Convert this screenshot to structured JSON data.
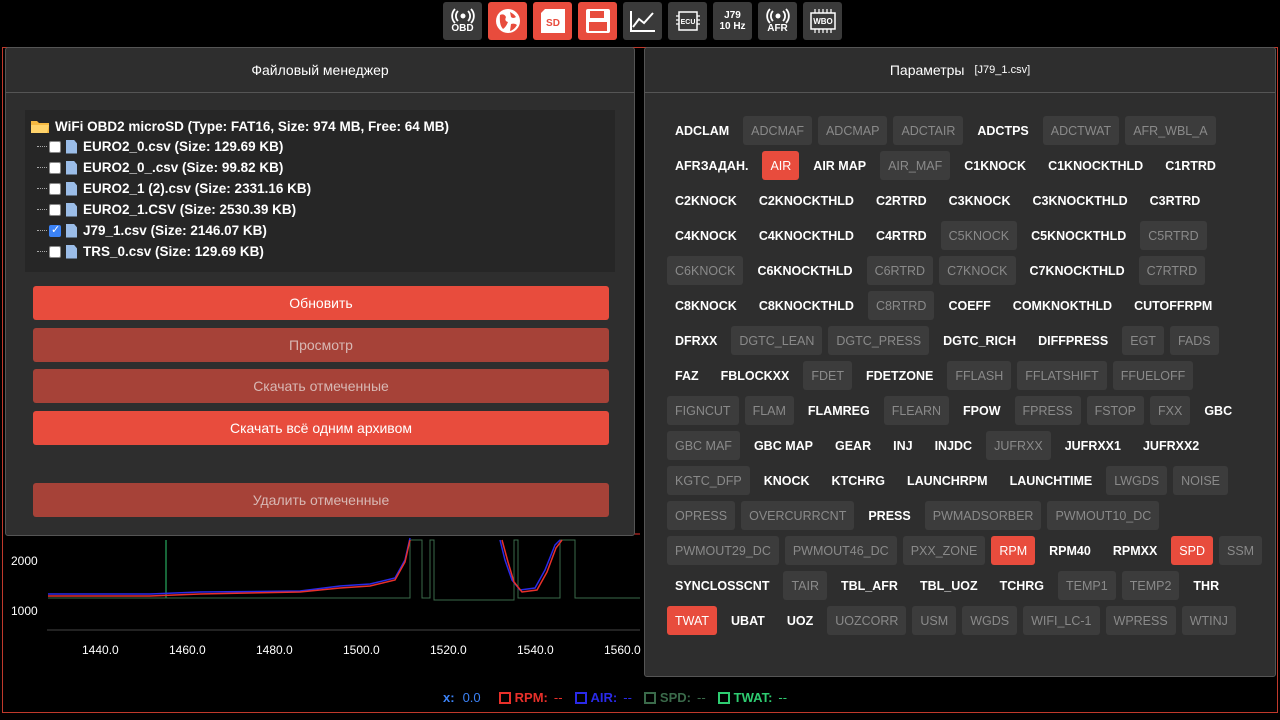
{
  "toolbar": [
    {
      "label": "OBD",
      "icon": "wireless-icon",
      "active": false
    },
    {
      "label": "",
      "icon": "globe-icon",
      "active": true
    },
    {
      "label": "SD",
      "icon": "sd-card-icon",
      "active": true
    },
    {
      "label": "",
      "icon": "floppy-disk-icon",
      "active": true
    },
    {
      "label": "",
      "icon": "chart-icon",
      "active": false
    },
    {
      "label": "ECU",
      "icon": "ecu-chip-icon",
      "active": false
    },
    {
      "label": "J79\n10 Hz",
      "icon": "",
      "active": false
    },
    {
      "label": "AFR",
      "icon": "wireless-icon",
      "active": false
    },
    {
      "label": "WBO",
      "icon": "wbo-chip-icon",
      "active": false
    }
  ],
  "chart": {
    "y_ticks": [
      "2000",
      "1000"
    ],
    "x_ticks": [
      "1440.0",
      "1460.0",
      "1480.0",
      "1500.0",
      "1520.0",
      "1540.0",
      "1560.0"
    ]
  },
  "legend": {
    "x_label": "x:",
    "x_value": "0.0",
    "series": [
      {
        "name": "RPM:",
        "value": "--",
        "color": "#e8302a"
      },
      {
        "name": "AIR:",
        "value": "--",
        "color": "#2a2ae8"
      },
      {
        "name": "SPD:",
        "value": "--",
        "color": "#3a6a4a"
      },
      {
        "name": "TWAT:",
        "value": "--",
        "color": "#2ecc71"
      }
    ]
  },
  "file_manager": {
    "title": "Файловый менеджер",
    "root": "WiFi OBD2 microSD (Type: FAT16, Size: 974 MB, Free: 64 MB)",
    "files": [
      {
        "name": "EURO2_0.csv (Size: 129.69 KB)",
        "checked": false
      },
      {
        "name": "EURO2_0_.csv (Size: 99.82 KB)",
        "checked": false
      },
      {
        "name": "EURO2_1 (2).csv (Size: 2331.16 KB)",
        "checked": false
      },
      {
        "name": "EURO2_1.CSV (Size: 2530.39 KB)",
        "checked": false
      },
      {
        "name": "J79_1.csv (Size: 2146.07 KB)",
        "checked": true
      },
      {
        "name": "TRS_0.csv (Size: 129.69 KB)",
        "checked": false
      }
    ],
    "buttons": {
      "refresh": "Обновить",
      "view": "Просмотр",
      "download_checked": "Скачать отмеченные",
      "download_all": "Скачать всё одним архивом",
      "delete_checked": "Удалить отмеченные"
    }
  },
  "params": {
    "title": "Параметры",
    "file": "[J79_1.csv]",
    "tags": [
      {
        "t": "ADCLAM",
        "s": "on"
      },
      {
        "t": "ADCMAF",
        "s": "off"
      },
      {
        "t": "ADCMAP",
        "s": "off"
      },
      {
        "t": "ADCTAIR",
        "s": "off"
      },
      {
        "t": "ADCTPS",
        "s": "on"
      },
      {
        "t": "ADCTWAT",
        "s": "off"
      },
      {
        "t": "AFR_WBL_A",
        "s": "off"
      },
      {
        "t": "AFRЗАДАН.",
        "s": "on"
      },
      {
        "t": "AIR",
        "s": "sel"
      },
      {
        "t": "AIR MAP",
        "s": "on"
      },
      {
        "t": "AIR_MAF",
        "s": "off"
      },
      {
        "t": "C1KNOCK",
        "s": "on"
      },
      {
        "t": "C1KNOCKTHLD",
        "s": "on"
      },
      {
        "t": "C1RTRD",
        "s": "on"
      },
      {
        "t": "C2KNOCK",
        "s": "on"
      },
      {
        "t": "C2KNOCKTHLD",
        "s": "on"
      },
      {
        "t": "C2RTRD",
        "s": "on"
      },
      {
        "t": "C3KNOCK",
        "s": "on"
      },
      {
        "t": "C3KNOCKTHLD",
        "s": "on"
      },
      {
        "t": "C3RTRD",
        "s": "on"
      },
      {
        "t": "C4KNOCK",
        "s": "on"
      },
      {
        "t": "C4KNOCKTHLD",
        "s": "on"
      },
      {
        "t": "C4RTRD",
        "s": "on"
      },
      {
        "t": "C5KNOCK",
        "s": "off"
      },
      {
        "t": "C5KNOCKTHLD",
        "s": "on"
      },
      {
        "t": "C5RTRD",
        "s": "off"
      },
      {
        "t": "C6KNOCK",
        "s": "off"
      },
      {
        "t": "C6KNOCKTHLD",
        "s": "on"
      },
      {
        "t": "C6RTRD",
        "s": "off"
      },
      {
        "t": "C7KNOCK",
        "s": "off"
      },
      {
        "t": "C7KNOCKTHLD",
        "s": "on"
      },
      {
        "t": "C7RTRD",
        "s": "off"
      },
      {
        "t": "C8KNOCK",
        "s": "on"
      },
      {
        "t": "C8KNOCKTHLD",
        "s": "on"
      },
      {
        "t": "C8RTRD",
        "s": "off"
      },
      {
        "t": "COEFF",
        "s": "on"
      },
      {
        "t": "COMKNOKTHLD",
        "s": "on"
      },
      {
        "t": "CUTOFFRPM",
        "s": "on"
      },
      {
        "t": "DFRXX",
        "s": "on"
      },
      {
        "t": "DGTC_LEAN",
        "s": "off"
      },
      {
        "t": "DGTC_PRESS",
        "s": "off"
      },
      {
        "t": "DGTC_RICH",
        "s": "on"
      },
      {
        "t": "DIFFPRESS",
        "s": "on"
      },
      {
        "t": "EGT",
        "s": "off"
      },
      {
        "t": "FADS",
        "s": "off"
      },
      {
        "t": "FAZ",
        "s": "on"
      },
      {
        "t": "FBLOCKXX",
        "s": "on"
      },
      {
        "t": "FDET",
        "s": "off"
      },
      {
        "t": "FDETZONE",
        "s": "on"
      },
      {
        "t": "FFLASH",
        "s": "off"
      },
      {
        "t": "FFLATSHIFT",
        "s": "off"
      },
      {
        "t": "FFUELOFF",
        "s": "off"
      },
      {
        "t": "FIGNCUT",
        "s": "off"
      },
      {
        "t": "FLAM",
        "s": "off"
      },
      {
        "t": "FLAMREG",
        "s": "on"
      },
      {
        "t": "FLEARN",
        "s": "off"
      },
      {
        "t": "FPOW",
        "s": "on"
      },
      {
        "t": "FPRESS",
        "s": "off"
      },
      {
        "t": "FSTOP",
        "s": "off"
      },
      {
        "t": "FXX",
        "s": "off"
      },
      {
        "t": "GBC",
        "s": "on"
      },
      {
        "t": "GBC MAF",
        "s": "off"
      },
      {
        "t": "GBC MAP",
        "s": "on"
      },
      {
        "t": "GEAR",
        "s": "on"
      },
      {
        "t": "INJ",
        "s": "on"
      },
      {
        "t": "INJDC",
        "s": "on"
      },
      {
        "t": "JUFRXX",
        "s": "off"
      },
      {
        "t": "JUFRXX1",
        "s": "on"
      },
      {
        "t": "JUFRXX2",
        "s": "on"
      },
      {
        "t": "KGTC_DFP",
        "s": "off"
      },
      {
        "t": "KNOCK",
        "s": "on"
      },
      {
        "t": "KTCHRG",
        "s": "on"
      },
      {
        "t": "LAUNCHRPM",
        "s": "on"
      },
      {
        "t": "LAUNCHTIME",
        "s": "on"
      },
      {
        "t": "LWGDS",
        "s": "off"
      },
      {
        "t": "NOISE",
        "s": "off"
      },
      {
        "t": "OPRESS",
        "s": "off"
      },
      {
        "t": "OVERCURRCNT",
        "s": "off"
      },
      {
        "t": "PRESS",
        "s": "on"
      },
      {
        "t": "PWMADSORBER",
        "s": "off"
      },
      {
        "t": "PWMOUT10_DC",
        "s": "off"
      },
      {
        "t": "PWMOUT29_DC",
        "s": "off"
      },
      {
        "t": "PWMOUT46_DC",
        "s": "off"
      },
      {
        "t": "PXX_ZONE",
        "s": "off"
      },
      {
        "t": "RPM",
        "s": "sel"
      },
      {
        "t": "RPM40",
        "s": "on"
      },
      {
        "t": "RPMXX",
        "s": "on"
      },
      {
        "t": "SPD",
        "s": "sel"
      },
      {
        "t": "SSM",
        "s": "off"
      },
      {
        "t": "SYNCLOSSCNT",
        "s": "on"
      },
      {
        "t": "TAIR",
        "s": "off"
      },
      {
        "t": "TBL_AFR",
        "s": "on"
      },
      {
        "t": "TBL_UOZ",
        "s": "on"
      },
      {
        "t": "TCHRG",
        "s": "on"
      },
      {
        "t": "TEMP1",
        "s": "off"
      },
      {
        "t": "TEMP2",
        "s": "off"
      },
      {
        "t": "THR",
        "s": "on"
      },
      {
        "t": "TWAT",
        "s": "sel"
      },
      {
        "t": "UBAT",
        "s": "on"
      },
      {
        "t": "UOZ",
        "s": "on"
      },
      {
        "t": "UOZCORR",
        "s": "off"
      },
      {
        "t": "USM",
        "s": "off"
      },
      {
        "t": "WGDS",
        "s": "off"
      },
      {
        "t": "WIFI_LC-1",
        "s": "off"
      },
      {
        "t": "WPRESS",
        "s": "off"
      },
      {
        "t": "WTINJ",
        "s": "off"
      }
    ]
  }
}
